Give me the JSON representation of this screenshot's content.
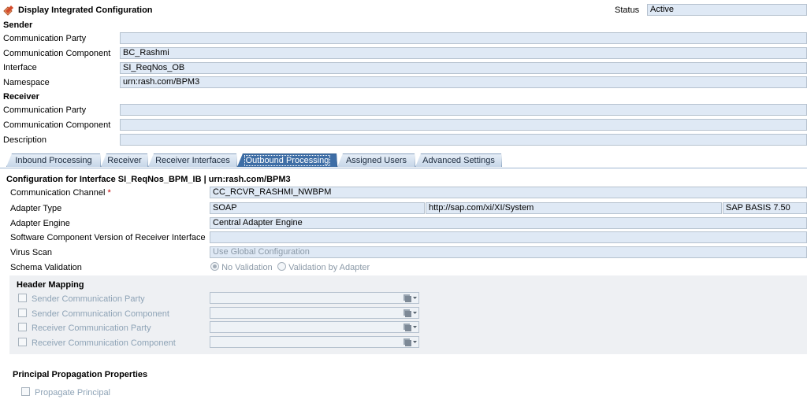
{
  "header": {
    "title": "Display Integrated Configuration",
    "status_label": "Status",
    "status_value": "Active"
  },
  "sender": {
    "heading": "Sender",
    "fields": [
      {
        "label": "Communication Party",
        "value": ""
      },
      {
        "label": "Communication Component",
        "value": "BC_Rashmi"
      },
      {
        "label": "Interface",
        "value": "SI_ReqNos_OB"
      },
      {
        "label": "Namespace",
        "value": "urn:rash.com/BPM3"
      }
    ]
  },
  "receiver": {
    "heading": "Receiver",
    "fields": [
      {
        "label": "Communication Party",
        "value": ""
      },
      {
        "label": "Communication Component",
        "value": ""
      },
      {
        "label": "Description",
        "value": ""
      }
    ]
  },
  "tabs": [
    {
      "label": "Inbound Processing"
    },
    {
      "label": "Receiver"
    },
    {
      "label": "Receiver Interfaces"
    },
    {
      "label": "Outbound Processing",
      "active": true
    },
    {
      "label": "Assigned Users"
    },
    {
      "label": "Advanced Settings"
    }
  ],
  "outbound": {
    "config_title": "Configuration for Interface SI_ReqNos_BPM_IB | urn:rash.com/BPM3",
    "channel_label": "Communication Channel",
    "required_mark": "*",
    "channel_value": "CC_RCVR_RASHMI_NWBPM",
    "adapter_type_label": "Adapter Type",
    "adapter_type_value": "SOAP",
    "adapter_namespace": "http://sap.com/xi/XI/System",
    "adapter_swcv": "SAP BASIS 7.50",
    "engine_label": "Adapter Engine",
    "engine_value": "Central Adapter Engine",
    "swcv_label": "Software Component Version of Receiver Interface",
    "swcv_value": "",
    "virus_label": "Virus Scan",
    "virus_value": "Use Global Configuration",
    "schema_label": "Schema Validation",
    "schema_options": [
      "No Validation",
      "Validation by Adapter"
    ],
    "schema_selected": "No Validation"
  },
  "header_mapping": {
    "title": "Header Mapping",
    "rows": [
      {
        "label": "Sender Communication Party",
        "checked": false,
        "value": ""
      },
      {
        "label": "Sender Communication Component",
        "checked": false,
        "value": ""
      },
      {
        "label": "Receiver Communication Party",
        "checked": false,
        "value": ""
      },
      {
        "label": "Receiver Communication Component",
        "checked": false,
        "value": ""
      }
    ]
  },
  "principal": {
    "title": "Principal Propagation Properties",
    "checkbox_label": "Propagate Principal",
    "checked": false
  },
  "colors": {
    "field_bg": "#dfe9f5",
    "active_tab": "#3e6ea6",
    "required": "#c00000"
  }
}
